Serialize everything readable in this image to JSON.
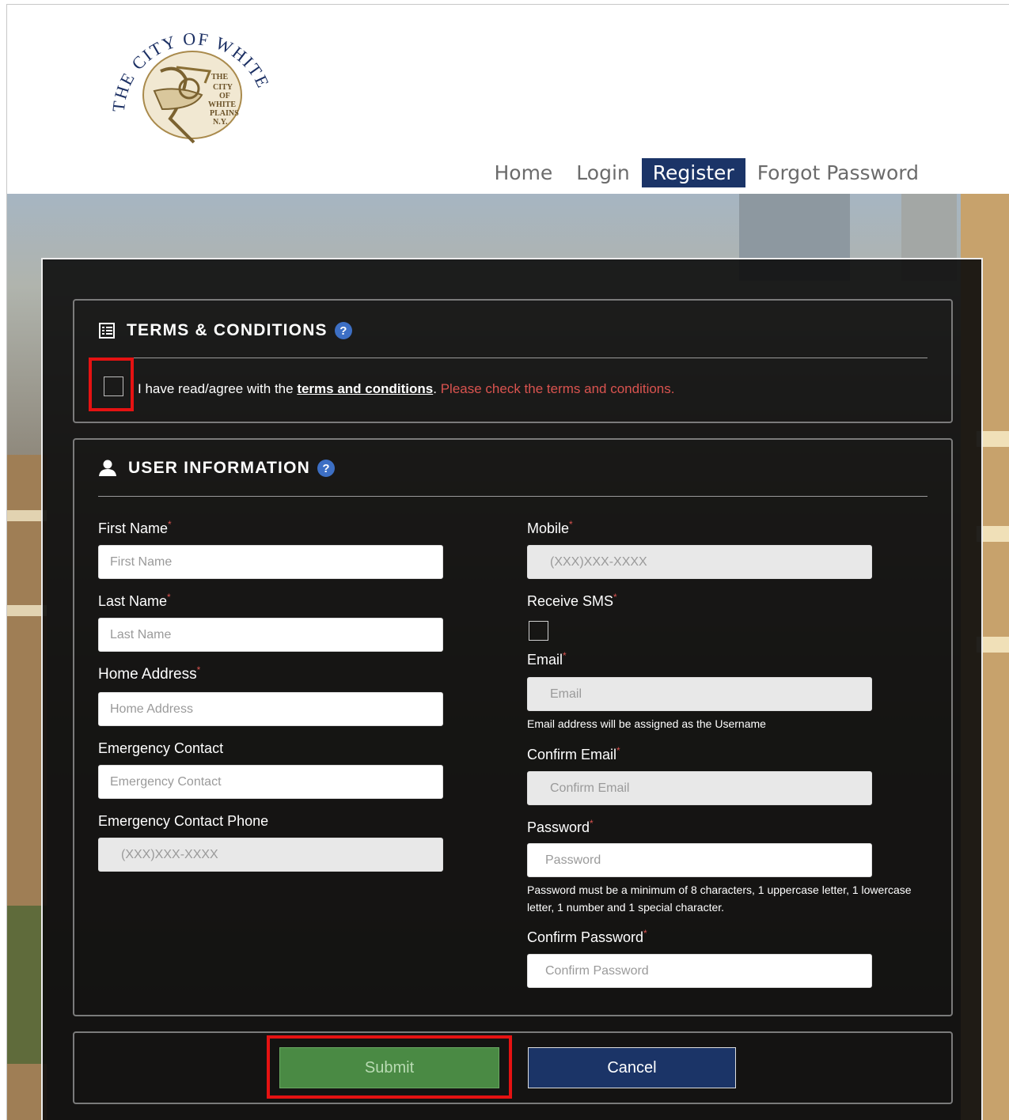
{
  "logo": {
    "ring_text": "THE CITY OF WHITE PLAINS",
    "seal_lines": [
      "THE",
      "CITY",
      "OF",
      "WHITE",
      "PLAINS",
      "N.Y."
    ]
  },
  "nav": {
    "items": [
      {
        "label": "Home",
        "active": false
      },
      {
        "label": "Login",
        "active": false
      },
      {
        "label": "Register",
        "active": true
      },
      {
        "label": "Forgot Password",
        "active": false
      }
    ]
  },
  "terms": {
    "title": "TERMS & CONDITIONS",
    "help_label": "?",
    "agree_prefix": "I have read/agree with the",
    "link_text": "terms and conditions",
    "agree_suffix": ".",
    "error": "Please check the terms and conditions.",
    "checked": false
  },
  "user_info": {
    "title": "USER INFORMATION",
    "help_label": "?",
    "required_mark": "*",
    "first_name": {
      "label": "First Name",
      "placeholder": "First Name"
    },
    "last_name": {
      "label": "Last Name",
      "placeholder": "Last Name"
    },
    "home_address": {
      "label": "Home Address",
      "placeholder": "Home Address"
    },
    "emergency_contact": {
      "label": "Emergency Contact",
      "placeholder": "Emergency Contact"
    },
    "emergency_phone": {
      "label": "Emergency Contact Phone",
      "placeholder": "(XXX)XXX-XXXX"
    },
    "mobile": {
      "label": "Mobile",
      "placeholder": "(XXX)XXX-XXXX"
    },
    "receive_sms": {
      "label": "Receive SMS",
      "checked": false
    },
    "email": {
      "label": "Email",
      "placeholder": "Email",
      "hint": "Email address will be assigned as the Username"
    },
    "confirm_email": {
      "label": "Confirm Email",
      "placeholder": "Confirm Email"
    },
    "password": {
      "label": "Password",
      "placeholder": "Password",
      "hint": "Password must be a minimum of 8 characters, 1 uppercase letter, 1 lowercase letter, 1 number and 1 special character."
    },
    "confirm_password": {
      "label": "Confirm Password",
      "placeholder": "Confirm Password"
    }
  },
  "actions": {
    "submit": "Submit",
    "cancel": "Cancel"
  },
  "colors": {
    "nav_active": "#1b3467",
    "required": "#d9534f",
    "error": "#d9534f",
    "submit": "#4a8a44",
    "cancel": "#1b3467",
    "highlight": "#e51212",
    "help_icon": "#3d6fc4"
  }
}
